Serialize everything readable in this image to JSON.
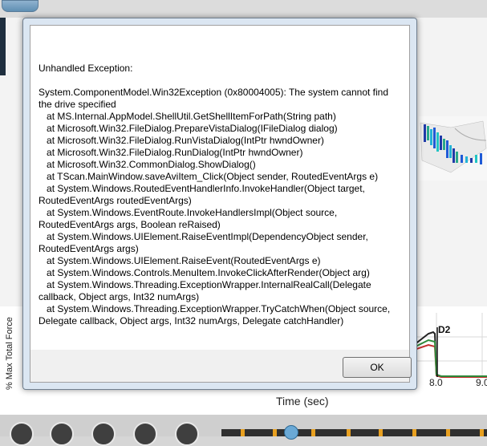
{
  "dialog": {
    "title": "Unhandled Exception:",
    "message": "System.ComponentModel.Win32Exception (0x80004005): The system cannot find the drive specified\n   at MS.Internal.AppModel.ShellUtil.GetShellItemForPath(String path)\n   at Microsoft.Win32.FileDialog.PrepareVistaDialog(IFileDialog dialog)\n   at Microsoft.Win32.FileDialog.RunVistaDialog(IntPtr hwndOwner)\n   at Microsoft.Win32.FileDialog.RunDialog(IntPtr hwndOwner)\n   at Microsoft.Win32.CommonDialog.ShowDialog()\n   at TScan.MainWindow.saveAviItem_Click(Object sender, RoutedEventArgs e)\n   at System.Windows.RoutedEventHandlerInfo.InvokeHandler(Object target, RoutedEventArgs routedEventArgs)\n   at System.Windows.EventRoute.InvokeHandlersImpl(Object source, RoutedEventArgs args, Boolean reRaised)\n   at System.Windows.UIElement.RaiseEventImpl(DependencyObject sender, RoutedEventArgs args)\n   at System.Windows.UIElement.RaiseEvent(RoutedEventArgs e)\n   at System.Windows.Controls.MenuItem.InvokeClickAfterRender(Object arg)\n   at System.Windows.Threading.ExceptionWrapper.InternalRealCall(Delegate callback, Object args, Int32 numArgs)\n   at System.Windows.Threading.ExceptionWrapper.TryCatchWhen(Object source, Delegate callback, Object args, Int32 numArgs, Delegate catchHandler)",
    "ok_label": "OK"
  },
  "background": {
    "y_axis_label": "% Max Total Force",
    "x_axis_label": "Time (sec)",
    "ticks": [
      "8.0",
      "9.0"
    ],
    "marker_label": "D2"
  },
  "colors": {
    "dialog_frame": "#dbe6f2",
    "green_bar": "#8fd69a",
    "red_bar": "#d36b6b"
  }
}
